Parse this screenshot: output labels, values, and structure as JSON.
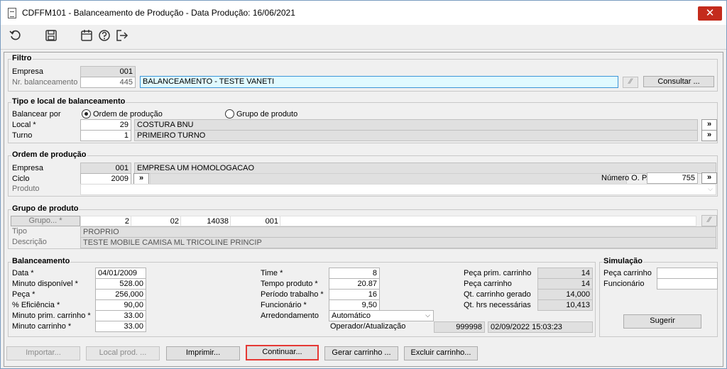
{
  "window": {
    "title": "CDFFM101 - Balanceamento de Produção - Data Produção: 16/06/2021",
    "close_glyph": "✕"
  },
  "toolbar": {
    "icons": [
      "undo-icon",
      "save-icon",
      "calendar-icon",
      "help-icon",
      "exit-icon"
    ]
  },
  "filtro": {
    "title": "Filtro",
    "empresa_label": "Empresa",
    "empresa_value": "001",
    "nr_label": "Nr. balanceamento",
    "nr_value": "445",
    "descricao_value": "BALANCEAMENTO - TESTE VANETI",
    "small_btn": "⁄⁄",
    "consultar_label": "Consultar ..."
  },
  "tipo": {
    "title": "Tipo e local de balanceamento",
    "balancear_label": "Balancear por",
    "radio_ordem": "Ordem de produção",
    "radio_grupo": "Grupo de produto",
    "local_label": "Local *",
    "local_code": "29",
    "local_name": "COSTURA BNU",
    "turno_label": "Turno",
    "turno_code": "1",
    "turno_name": "PRIMEIRO TURNO",
    "more": "»"
  },
  "ordem": {
    "title": "Ordem de produção",
    "empresa_label": "Empresa",
    "empresa_code": "001",
    "empresa_name": "EMPRESA UM HOMOLOGACAO",
    "ciclo_label": "Ciclo",
    "ciclo_value": "2009",
    "more": "»",
    "numero_label": "Número O. P.",
    "numero_value": "755",
    "produto_label": "Produto",
    "produto_chevron": "⌵"
  },
  "grupo": {
    "title": "Grupo de produto",
    "grupo_btn": "Grupo... *",
    "cells": [
      "2",
      "02",
      "14038",
      "001"
    ],
    "small_btn": "⁄⁄",
    "tipo_label": "Tipo",
    "tipo_value": "PROPRIO",
    "descricao_label": "Descrição",
    "descricao_value": "TESTE MOBILE CAMISA ML TRICOLINE PRINCIP"
  },
  "balanceamento": {
    "title": "Balanceamento",
    "left": [
      {
        "label": "Data *",
        "value": "04/01/2009"
      },
      {
        "label": "Minuto disponível *",
        "value": "528.00"
      },
      {
        "label": "Peça *",
        "value": "256,000"
      },
      {
        "label": "% Eficiência *",
        "value": "90,00"
      },
      {
        "label": "Minuto prim. carrinho *",
        "value": "33.00"
      },
      {
        "label": "Minuto carrinho *",
        "value": "33.00"
      }
    ],
    "mid": [
      {
        "label": "Time *",
        "value": "8"
      },
      {
        "label": "Tempo produto *",
        "value": "20.87"
      },
      {
        "label": "Período trabalho *",
        "value": "16"
      },
      {
        "label": "Funcionário *",
        "value": "9,50"
      }
    ],
    "arred_label": "Arredondamento",
    "arred_value": "Automático",
    "arred_chevron": "⌵",
    "operador_label": "Operador/Atualização",
    "operador_value": "999998",
    "atualizacao_value": "02/09/2022 15:03:23",
    "right": [
      {
        "label": "Peça prim. carrinho",
        "value": "14"
      },
      {
        "label": "Peça carrinho",
        "value": "14"
      },
      {
        "label": "Qt. carrinho gerado",
        "value": "14,000"
      },
      {
        "label": "Qt. hrs necessárias",
        "value": "10,413"
      }
    ]
  },
  "simulacao": {
    "title": "Simulação",
    "peca_label": "Peça carrinho",
    "peca_value": "",
    "func_label": "Funcionário",
    "func_value": "",
    "sugerir_label": "Sugerir"
  },
  "bottom_buttons": {
    "importar": "Importar...",
    "local_prod": "Local prod. ...",
    "imprimir": "Imprimir...",
    "continuar": "Continuar...",
    "gerar": "Gerar carrinho ...",
    "excluir": "Excluir carrinho..."
  }
}
